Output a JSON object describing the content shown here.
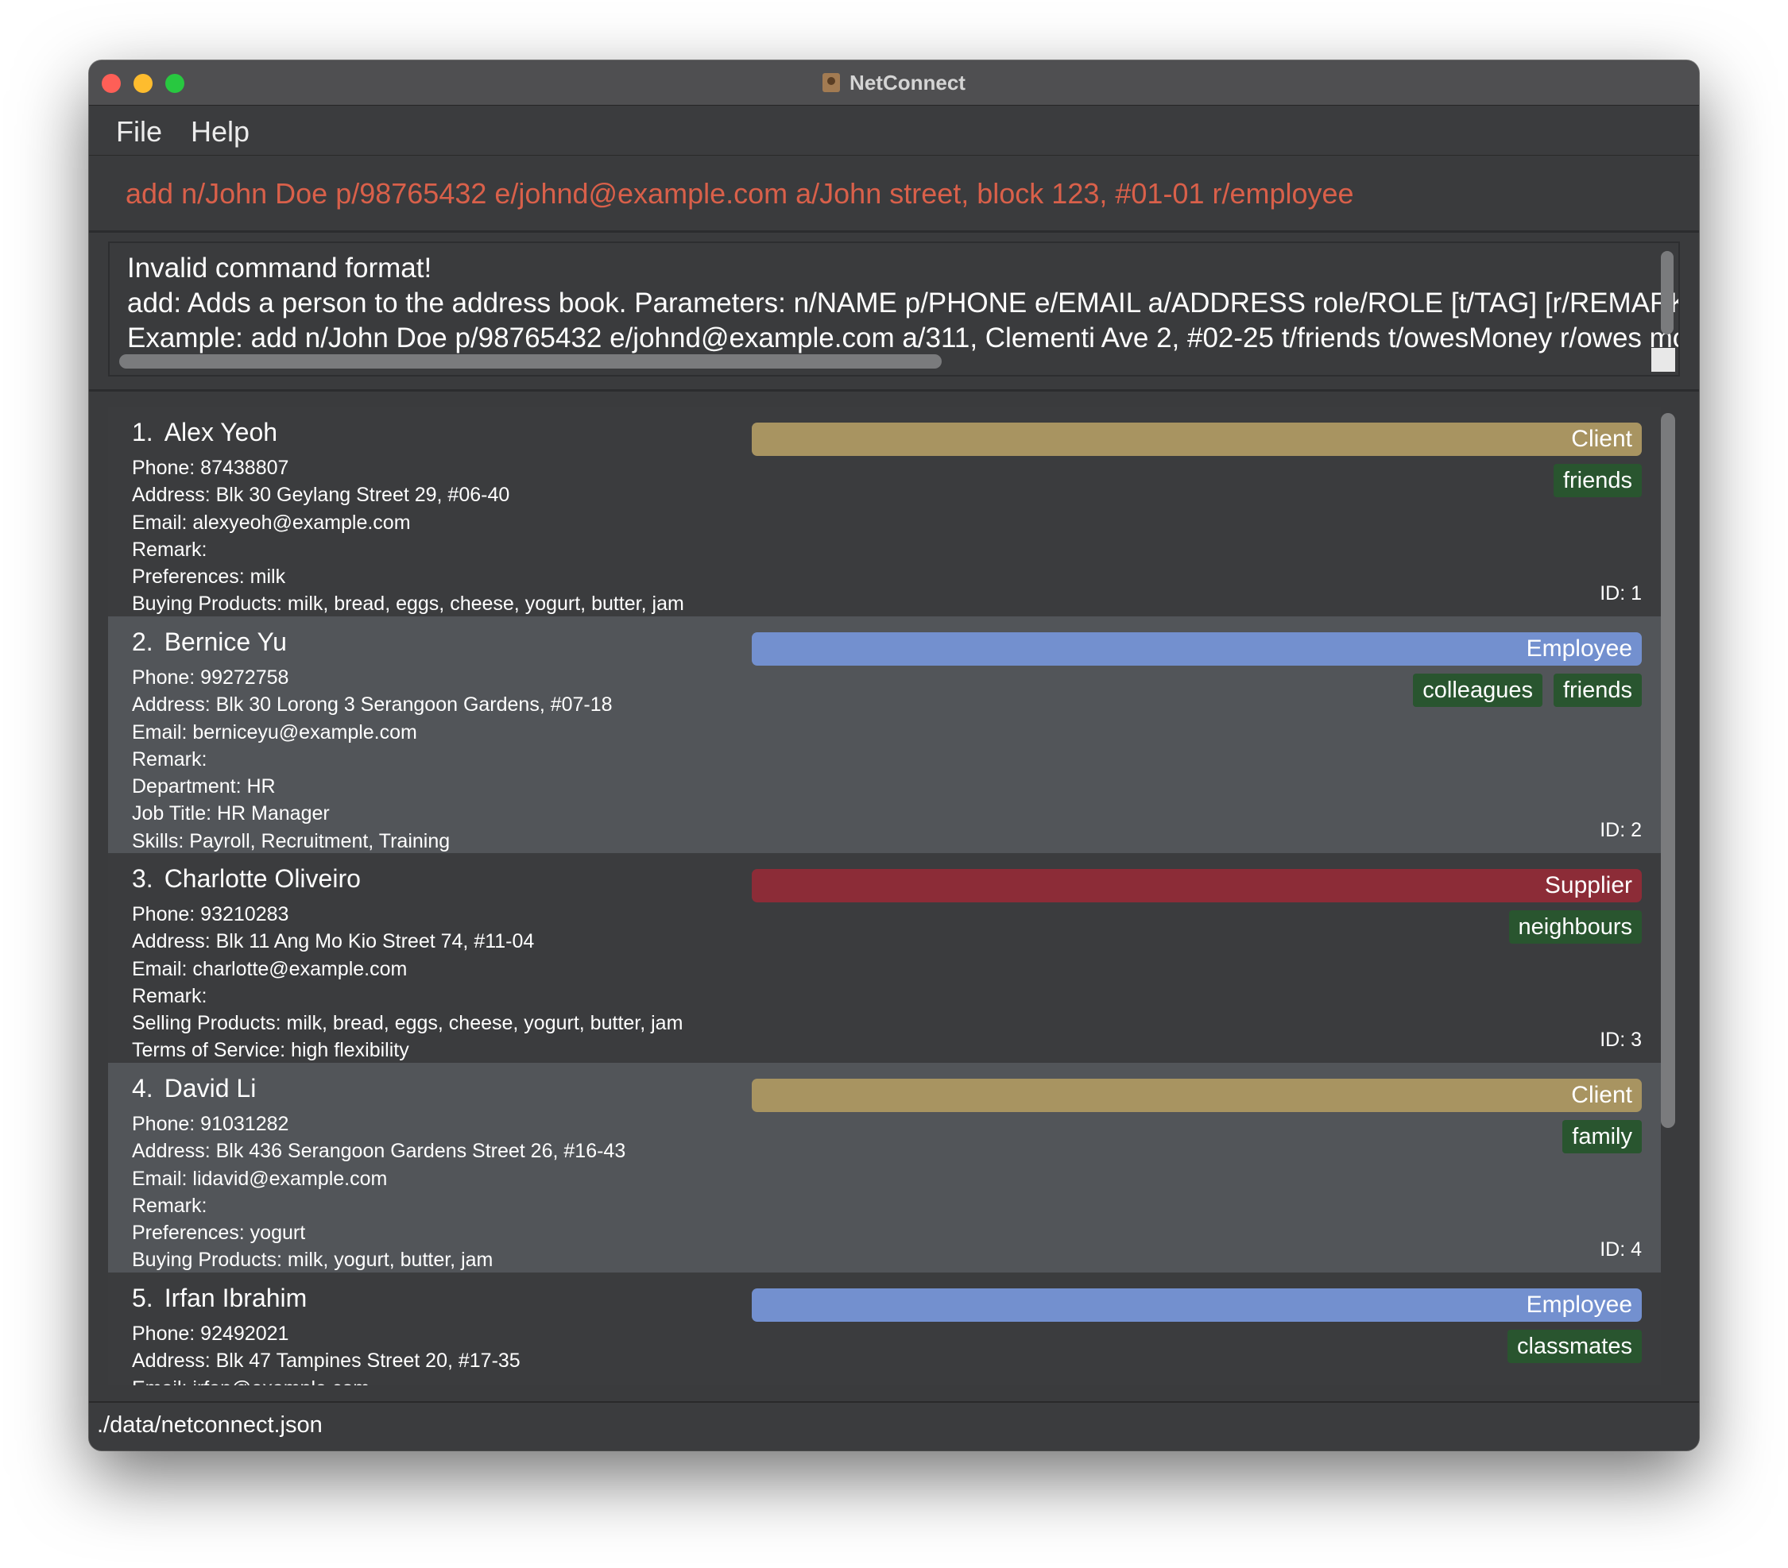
{
  "window": {
    "title": "NetConnect"
  },
  "menu": {
    "file": "File",
    "help": "Help"
  },
  "command": {
    "value": "add n/John Doe p/98765432 e/johnd@example.com a/John street, block 123, #01-01 r/employee"
  },
  "result": {
    "line1": "Invalid command format!",
    "line2": "add: Adds a person to the address book. Parameters: n/NAME p/PHONE e/EMAIL a/ADDRESS role/ROLE [t/TAG] [r/REMARK] [dept/D",
    "line3": "Example: add n/John Doe p/98765432 e/johnd@example.com a/311, Clementi Ave 2, #02-25 t/friends t/owesMoney r/owes money r"
  },
  "persons": [
    {
      "index": "1.",
      "name": "Alex Yeoh",
      "role": "Client",
      "tags": [
        "friends"
      ],
      "details": [
        "Phone: 87438807",
        "Address: Blk 30 Geylang Street 29, #06-40",
        "Email: alexyeoh@example.com",
        "Remark:",
        "Preferences: milk",
        "Buying Products: milk, bread, eggs, cheese, yogurt, butter, jam"
      ],
      "id": "ID: 1"
    },
    {
      "index": "2.",
      "name": "Bernice Yu",
      "role": "Employee",
      "tags": [
        "colleagues",
        "friends"
      ],
      "details": [
        "Phone: 99272758",
        "Address: Blk 30 Lorong 3 Serangoon Gardens, #07-18",
        "Email: berniceyu@example.com",
        "Remark:",
        "Department: HR",
        "Job Title: HR Manager",
        "Skills: Payroll, Recruitment, Training"
      ],
      "id": "ID: 2"
    },
    {
      "index": "3.",
      "name": "Charlotte Oliveiro",
      "role": "Supplier",
      "tags": [
        "neighbours"
      ],
      "details": [
        "Phone: 93210283",
        "Address: Blk 11 Ang Mo Kio Street 74, #11-04",
        "Email: charlotte@example.com",
        "Remark:",
        "Selling Products: milk, bread, eggs, cheese, yogurt, butter, jam",
        "Terms of Service: high flexibility"
      ],
      "id": "ID: 3"
    },
    {
      "index": "4.",
      "name": "David Li",
      "role": "Client",
      "tags": [
        "family"
      ],
      "details": [
        "Phone: 91031282",
        "Address: Blk 436 Serangoon Gardens Street 26, #16-43",
        "Email: lidavid@example.com",
        "Remark:",
        "Preferences: yogurt",
        "Buying Products: milk, yogurt, butter, jam"
      ],
      "id": "ID: 4"
    },
    {
      "index": "5.",
      "name": "Irfan Ibrahim",
      "role": "Employee",
      "tags": [
        "classmates"
      ],
      "details": [
        "Phone: 92492021",
        "Address: Blk 47 Tampines Street 20, #17-35",
        "Email: irfan@example.com"
      ],
      "id": ""
    }
  ],
  "status": {
    "path": "./data/netconnect.json"
  },
  "colors": {
    "client": "#a89461",
    "employee": "#7390cf",
    "supplier": "#8c2c37",
    "tag": "#29552f",
    "command_text": "#d9604a"
  },
  "icons": {
    "app": "contact-book-icon",
    "close": "close-window-icon",
    "minimize": "minimize-window-icon",
    "maximize": "maximize-window-icon"
  }
}
